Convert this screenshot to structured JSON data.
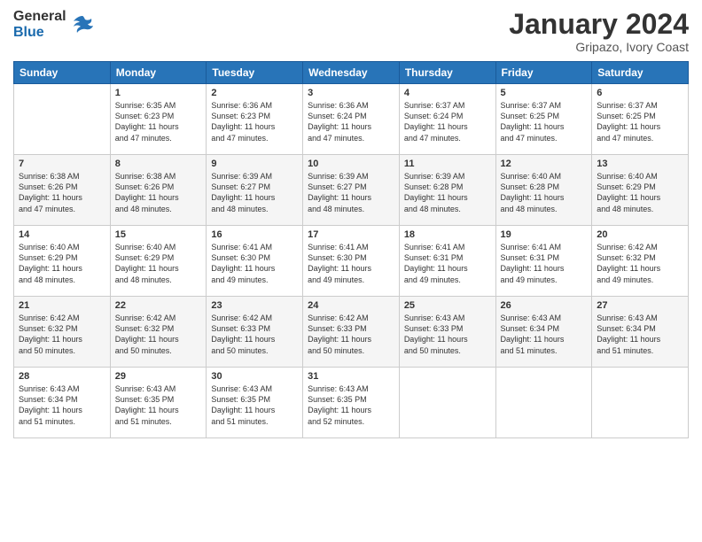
{
  "header": {
    "logo_general": "General",
    "logo_blue": "Blue",
    "title": "January 2024",
    "subtitle": "Gripazo, Ivory Coast"
  },
  "calendar": {
    "days_of_week": [
      "Sunday",
      "Monday",
      "Tuesday",
      "Wednesday",
      "Thursday",
      "Friday",
      "Saturday"
    ],
    "weeks": [
      [
        {
          "day": "",
          "info": ""
        },
        {
          "day": "1",
          "info": "Sunrise: 6:35 AM\nSunset: 6:23 PM\nDaylight: 11 hours\nand 47 minutes."
        },
        {
          "day": "2",
          "info": "Sunrise: 6:36 AM\nSunset: 6:23 PM\nDaylight: 11 hours\nand 47 minutes."
        },
        {
          "day": "3",
          "info": "Sunrise: 6:36 AM\nSunset: 6:24 PM\nDaylight: 11 hours\nand 47 minutes."
        },
        {
          "day": "4",
          "info": "Sunrise: 6:37 AM\nSunset: 6:24 PM\nDaylight: 11 hours\nand 47 minutes."
        },
        {
          "day": "5",
          "info": "Sunrise: 6:37 AM\nSunset: 6:25 PM\nDaylight: 11 hours\nand 47 minutes."
        },
        {
          "day": "6",
          "info": "Sunrise: 6:37 AM\nSunset: 6:25 PM\nDaylight: 11 hours\nand 47 minutes."
        }
      ],
      [
        {
          "day": "7",
          "info": "Sunrise: 6:38 AM\nSunset: 6:26 PM\nDaylight: 11 hours\nand 47 minutes."
        },
        {
          "day": "8",
          "info": "Sunrise: 6:38 AM\nSunset: 6:26 PM\nDaylight: 11 hours\nand 48 minutes."
        },
        {
          "day": "9",
          "info": "Sunrise: 6:39 AM\nSunset: 6:27 PM\nDaylight: 11 hours\nand 48 minutes."
        },
        {
          "day": "10",
          "info": "Sunrise: 6:39 AM\nSunset: 6:27 PM\nDaylight: 11 hours\nand 48 minutes."
        },
        {
          "day": "11",
          "info": "Sunrise: 6:39 AM\nSunset: 6:28 PM\nDaylight: 11 hours\nand 48 minutes."
        },
        {
          "day": "12",
          "info": "Sunrise: 6:40 AM\nSunset: 6:28 PM\nDaylight: 11 hours\nand 48 minutes."
        },
        {
          "day": "13",
          "info": "Sunrise: 6:40 AM\nSunset: 6:29 PM\nDaylight: 11 hours\nand 48 minutes."
        }
      ],
      [
        {
          "day": "14",
          "info": "Sunrise: 6:40 AM\nSunset: 6:29 PM\nDaylight: 11 hours\nand 48 minutes."
        },
        {
          "day": "15",
          "info": "Sunrise: 6:40 AM\nSunset: 6:29 PM\nDaylight: 11 hours\nand 48 minutes."
        },
        {
          "day": "16",
          "info": "Sunrise: 6:41 AM\nSunset: 6:30 PM\nDaylight: 11 hours\nand 49 minutes."
        },
        {
          "day": "17",
          "info": "Sunrise: 6:41 AM\nSunset: 6:30 PM\nDaylight: 11 hours\nand 49 minutes."
        },
        {
          "day": "18",
          "info": "Sunrise: 6:41 AM\nSunset: 6:31 PM\nDaylight: 11 hours\nand 49 minutes."
        },
        {
          "day": "19",
          "info": "Sunrise: 6:41 AM\nSunset: 6:31 PM\nDaylight: 11 hours\nand 49 minutes."
        },
        {
          "day": "20",
          "info": "Sunrise: 6:42 AM\nSunset: 6:32 PM\nDaylight: 11 hours\nand 49 minutes."
        }
      ],
      [
        {
          "day": "21",
          "info": "Sunrise: 6:42 AM\nSunset: 6:32 PM\nDaylight: 11 hours\nand 50 minutes."
        },
        {
          "day": "22",
          "info": "Sunrise: 6:42 AM\nSunset: 6:32 PM\nDaylight: 11 hours\nand 50 minutes."
        },
        {
          "day": "23",
          "info": "Sunrise: 6:42 AM\nSunset: 6:33 PM\nDaylight: 11 hours\nand 50 minutes."
        },
        {
          "day": "24",
          "info": "Sunrise: 6:42 AM\nSunset: 6:33 PM\nDaylight: 11 hours\nand 50 minutes."
        },
        {
          "day": "25",
          "info": "Sunrise: 6:43 AM\nSunset: 6:33 PM\nDaylight: 11 hours\nand 50 minutes."
        },
        {
          "day": "26",
          "info": "Sunrise: 6:43 AM\nSunset: 6:34 PM\nDaylight: 11 hours\nand 51 minutes."
        },
        {
          "day": "27",
          "info": "Sunrise: 6:43 AM\nSunset: 6:34 PM\nDaylight: 11 hours\nand 51 minutes."
        }
      ],
      [
        {
          "day": "28",
          "info": "Sunrise: 6:43 AM\nSunset: 6:34 PM\nDaylight: 11 hours\nand 51 minutes."
        },
        {
          "day": "29",
          "info": "Sunrise: 6:43 AM\nSunset: 6:35 PM\nDaylight: 11 hours\nand 51 minutes."
        },
        {
          "day": "30",
          "info": "Sunrise: 6:43 AM\nSunset: 6:35 PM\nDaylight: 11 hours\nand 51 minutes."
        },
        {
          "day": "31",
          "info": "Sunrise: 6:43 AM\nSunset: 6:35 PM\nDaylight: 11 hours\nand 52 minutes."
        },
        {
          "day": "",
          "info": ""
        },
        {
          "day": "",
          "info": ""
        },
        {
          "day": "",
          "info": ""
        }
      ]
    ]
  }
}
